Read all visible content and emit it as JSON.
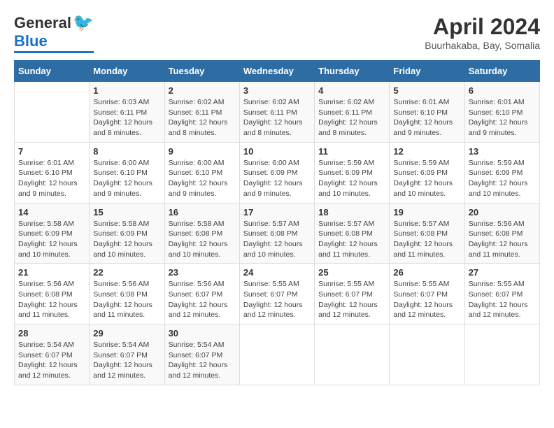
{
  "header": {
    "logo_general": "General",
    "logo_blue": "Blue",
    "title": "April 2024",
    "subtitle": "Buurhakaba, Bay, Somalia"
  },
  "columns": [
    "Sunday",
    "Monday",
    "Tuesday",
    "Wednesday",
    "Thursday",
    "Friday",
    "Saturday"
  ],
  "weeks": [
    [
      {
        "day": "",
        "sunrise": "",
        "sunset": "",
        "daylight": ""
      },
      {
        "day": "1",
        "sunrise": "Sunrise: 6:03 AM",
        "sunset": "Sunset: 6:11 PM",
        "daylight": "Daylight: 12 hours and 8 minutes."
      },
      {
        "day": "2",
        "sunrise": "Sunrise: 6:02 AM",
        "sunset": "Sunset: 6:11 PM",
        "daylight": "Daylight: 12 hours and 8 minutes."
      },
      {
        "day": "3",
        "sunrise": "Sunrise: 6:02 AM",
        "sunset": "Sunset: 6:11 PM",
        "daylight": "Daylight: 12 hours and 8 minutes."
      },
      {
        "day": "4",
        "sunrise": "Sunrise: 6:02 AM",
        "sunset": "Sunset: 6:11 PM",
        "daylight": "Daylight: 12 hours and 8 minutes."
      },
      {
        "day": "5",
        "sunrise": "Sunrise: 6:01 AM",
        "sunset": "Sunset: 6:10 PM",
        "daylight": "Daylight: 12 hours and 9 minutes."
      },
      {
        "day": "6",
        "sunrise": "Sunrise: 6:01 AM",
        "sunset": "Sunset: 6:10 PM",
        "daylight": "Daylight: 12 hours and 9 minutes."
      }
    ],
    [
      {
        "day": "7",
        "sunrise": "Sunrise: 6:01 AM",
        "sunset": "Sunset: 6:10 PM",
        "daylight": "Daylight: 12 hours and 9 minutes."
      },
      {
        "day": "8",
        "sunrise": "Sunrise: 6:00 AM",
        "sunset": "Sunset: 6:10 PM",
        "daylight": "Daylight: 12 hours and 9 minutes."
      },
      {
        "day": "9",
        "sunrise": "Sunrise: 6:00 AM",
        "sunset": "Sunset: 6:10 PM",
        "daylight": "Daylight: 12 hours and 9 minutes."
      },
      {
        "day": "10",
        "sunrise": "Sunrise: 6:00 AM",
        "sunset": "Sunset: 6:09 PM",
        "daylight": "Daylight: 12 hours and 9 minutes."
      },
      {
        "day": "11",
        "sunrise": "Sunrise: 5:59 AM",
        "sunset": "Sunset: 6:09 PM",
        "daylight": "Daylight: 12 hours and 10 minutes."
      },
      {
        "day": "12",
        "sunrise": "Sunrise: 5:59 AM",
        "sunset": "Sunset: 6:09 PM",
        "daylight": "Daylight: 12 hours and 10 minutes."
      },
      {
        "day": "13",
        "sunrise": "Sunrise: 5:59 AM",
        "sunset": "Sunset: 6:09 PM",
        "daylight": "Daylight: 12 hours and 10 minutes."
      }
    ],
    [
      {
        "day": "14",
        "sunrise": "Sunrise: 5:58 AM",
        "sunset": "Sunset: 6:09 PM",
        "daylight": "Daylight: 12 hours and 10 minutes."
      },
      {
        "day": "15",
        "sunrise": "Sunrise: 5:58 AM",
        "sunset": "Sunset: 6:09 PM",
        "daylight": "Daylight: 12 hours and 10 minutes."
      },
      {
        "day": "16",
        "sunrise": "Sunrise: 5:58 AM",
        "sunset": "Sunset: 6:08 PM",
        "daylight": "Daylight: 12 hours and 10 minutes."
      },
      {
        "day": "17",
        "sunrise": "Sunrise: 5:57 AM",
        "sunset": "Sunset: 6:08 PM",
        "daylight": "Daylight: 12 hours and 10 minutes."
      },
      {
        "day": "18",
        "sunrise": "Sunrise: 5:57 AM",
        "sunset": "Sunset: 6:08 PM",
        "daylight": "Daylight: 12 hours and 11 minutes."
      },
      {
        "day": "19",
        "sunrise": "Sunrise: 5:57 AM",
        "sunset": "Sunset: 6:08 PM",
        "daylight": "Daylight: 12 hours and 11 minutes."
      },
      {
        "day": "20",
        "sunrise": "Sunrise: 5:56 AM",
        "sunset": "Sunset: 6:08 PM",
        "daylight": "Daylight: 12 hours and 11 minutes."
      }
    ],
    [
      {
        "day": "21",
        "sunrise": "Sunrise: 5:56 AM",
        "sunset": "Sunset: 6:08 PM",
        "daylight": "Daylight: 12 hours and 11 minutes."
      },
      {
        "day": "22",
        "sunrise": "Sunrise: 5:56 AM",
        "sunset": "Sunset: 6:08 PM",
        "daylight": "Daylight: 12 hours and 11 minutes."
      },
      {
        "day": "23",
        "sunrise": "Sunrise: 5:56 AM",
        "sunset": "Sunset: 6:07 PM",
        "daylight": "Daylight: 12 hours and 12 minutes."
      },
      {
        "day": "24",
        "sunrise": "Sunrise: 5:55 AM",
        "sunset": "Sunset: 6:07 PM",
        "daylight": "Daylight: 12 hours and 12 minutes."
      },
      {
        "day": "25",
        "sunrise": "Sunrise: 5:55 AM",
        "sunset": "Sunset: 6:07 PM",
        "daylight": "Daylight: 12 hours and 12 minutes."
      },
      {
        "day": "26",
        "sunrise": "Sunrise: 5:55 AM",
        "sunset": "Sunset: 6:07 PM",
        "daylight": "Daylight: 12 hours and 12 minutes."
      },
      {
        "day": "27",
        "sunrise": "Sunrise: 5:55 AM",
        "sunset": "Sunset: 6:07 PM",
        "daylight": "Daylight: 12 hours and 12 minutes."
      }
    ],
    [
      {
        "day": "28",
        "sunrise": "Sunrise: 5:54 AM",
        "sunset": "Sunset: 6:07 PM",
        "daylight": "Daylight: 12 hours and 12 minutes."
      },
      {
        "day": "29",
        "sunrise": "Sunrise: 5:54 AM",
        "sunset": "Sunset: 6:07 PM",
        "daylight": "Daylight: 12 hours and 12 minutes."
      },
      {
        "day": "30",
        "sunrise": "Sunrise: 5:54 AM",
        "sunset": "Sunset: 6:07 PM",
        "daylight": "Daylight: 12 hours and 12 minutes."
      },
      {
        "day": "",
        "sunrise": "",
        "sunset": "",
        "daylight": ""
      },
      {
        "day": "",
        "sunrise": "",
        "sunset": "",
        "daylight": ""
      },
      {
        "day": "",
        "sunrise": "",
        "sunset": "",
        "daylight": ""
      },
      {
        "day": "",
        "sunrise": "",
        "sunset": "",
        "daylight": ""
      }
    ]
  ]
}
